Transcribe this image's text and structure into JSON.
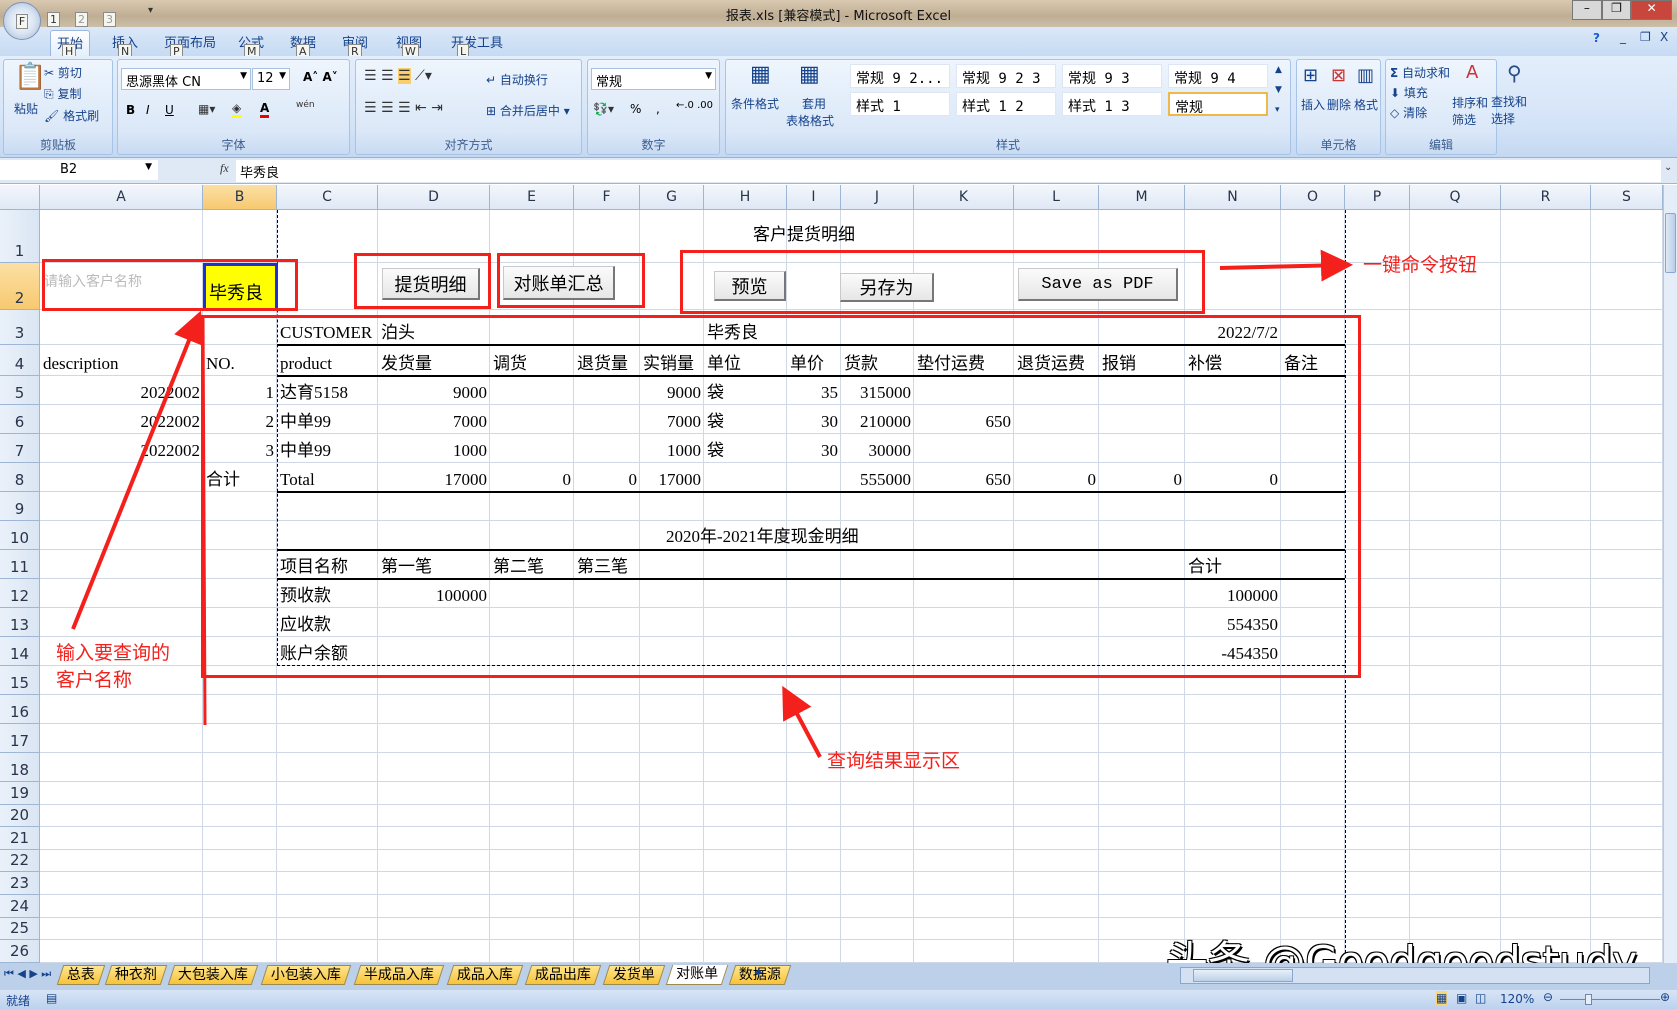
{
  "window": {
    "title": "报表.xls  [兼容模式] - Microsoft Excel",
    "office_button": "F",
    "qat_keys": [
      "1",
      "2",
      "3"
    ]
  },
  "ribbon": {
    "tabs": [
      {
        "label": "开始",
        "key": "H"
      },
      {
        "label": "插入",
        "key": "N"
      },
      {
        "label": "页面布局",
        "key": "P"
      },
      {
        "label": "公式",
        "key": "M"
      },
      {
        "label": "数据",
        "key": "A"
      },
      {
        "label": "审阅",
        "key": "R"
      },
      {
        "label": "视图",
        "key": "W"
      },
      {
        "label": "开发工具",
        "key": "L"
      }
    ],
    "active_tab": "开始",
    "clipboard": {
      "label": "剪贴板",
      "paste": "粘贴",
      "cut": "剪切",
      "copy": "复制",
      "format_painter": "格式刷"
    },
    "font": {
      "label": "字体",
      "font_name": "思源黑体 CN",
      "font_size": "12",
      "bold": "B",
      "italic": "I",
      "underline": "U",
      "phonetic": "wén"
    },
    "alignment": {
      "label": "对齐方式",
      "wrap": "自动换行",
      "merge": "合并后居中"
    },
    "number": {
      "label": "数字",
      "format": "常规",
      "percent": "%",
      "comma": ","
    },
    "styles": {
      "label": "样式",
      "conditional": "条件格式",
      "table_format_1": "套用",
      "table_format_2": "表格格式",
      "items": [
        "常规 9 2...",
        "常规 9 2 3",
        "常规 9 3",
        "常规 9 4",
        "样式 1",
        "样式 1 2",
        "样式 1 3",
        "常规"
      ]
    },
    "cells": {
      "label": "单元格",
      "insert": "插入",
      "delete": "删除",
      "format": "格式"
    },
    "editing": {
      "label": "编辑",
      "autosum": "自动求和",
      "fill": "填充",
      "clear": "清除",
      "sort_1": "排序和",
      "sort_2": "筛选",
      "find_1": "查找和",
      "find_2": "选择"
    }
  },
  "formula_bar": {
    "name_box": "B2",
    "fx": "fx",
    "value": "毕秀良"
  },
  "columns": [
    "A",
    "B",
    "C",
    "D",
    "E",
    "F",
    "G",
    "H",
    "I",
    "J",
    "K",
    "L",
    "M",
    "N",
    "O",
    "P",
    "Q",
    "R",
    "S"
  ],
  "rows": [
    "1",
    "2",
    "3",
    "4",
    "5",
    "6",
    "7",
    "8",
    "9",
    "10",
    "11",
    "12",
    "13",
    "14",
    "15",
    "16",
    "17",
    "18",
    "19",
    "20",
    "21",
    "22",
    "23",
    "24",
    "25",
    "26"
  ],
  "selected_cell": "B2",
  "sheet": {
    "title": "客户提货明细",
    "cash_title": "2020年-2021年度现金明细",
    "input_hint": "请输入客户名称",
    "customer_value": "毕秀良",
    "cells": {
      "C3": "CUSTOMER",
      "D3": "泊头",
      "H3": "毕秀良",
      "N3": "2022/7/2",
      "A4": "description",
      "B4": "NO.",
      "C4": "product",
      "D4": "发货量",
      "E4": "调货",
      "F4": "退货量",
      "G4": "实销量",
      "H4": "单位",
      "I4": "单价",
      "J4": "货款",
      "K4": "垫付运费",
      "L4": "退货运费",
      "M4": "报销",
      "N4": "补偿",
      "O4": "备注",
      "A5": "2022002",
      "B5": "1",
      "C5": "达育5158",
      "D5": "9000",
      "G5": "9000",
      "H5": "袋",
      "I5": "35",
      "J5": "315000",
      "A6": "2022002",
      "B6": "2",
      "C6": "中单99",
      "D6": "7000",
      "G6": "7000",
      "H6": "袋",
      "I6": "30",
      "J6": "210000",
      "K6": "650",
      "A7": "2022002",
      "B7": "3",
      "C7": "中单99",
      "D7": "1000",
      "G7": "1000",
      "H7": "袋",
      "I7": "30",
      "J7": "30000",
      "B8": "合计",
      "C8": "Total",
      "D8": "17000",
      "E8": "0",
      "F8": "0",
      "G8": "17000",
      "J8": "555000",
      "K8": "650",
      "L8": "0",
      "M8": "0",
      "N8": "0",
      "C11": "项目名称",
      "D11": "第一笔",
      "E11": "第二笔",
      "F11": "第三笔",
      "N11": "合计",
      "C12": "预收款",
      "D12": "100000",
      "N12": "100000",
      "C13": "应收款",
      "N13": "554350",
      "C14": "账户余额",
      "N14": "-454350"
    },
    "buttons": {
      "delivery_detail": "提货明细",
      "statement_summary": "对账单汇总",
      "preview": "预览",
      "save_as": "另存为",
      "save_pdf": "Save as PDF"
    }
  },
  "annotations": {
    "command_buttons": "一键命令按钮",
    "input_customer_1": "输入要查询的",
    "input_customer_2": "客户名称",
    "result_area": "查询结果显示区",
    "color": "#f4201c"
  },
  "sheet_tabs": [
    "总表",
    "种衣剂",
    "大包装入库",
    "小包装入库",
    "半成品入库",
    "成品入库",
    "成品出库",
    "发货单",
    "对账单",
    "数据源"
  ],
  "active_sheet": "对账单",
  "status": {
    "ready": "就绪",
    "zoom": "120%",
    "zoom_level": 120
  },
  "watermark": "头条 @Goodgoodstudy",
  "colors": {
    "selected_fill": "#ffff00",
    "selected_border": "#1f2fd6",
    "header_highlight": "#f8c970"
  }
}
